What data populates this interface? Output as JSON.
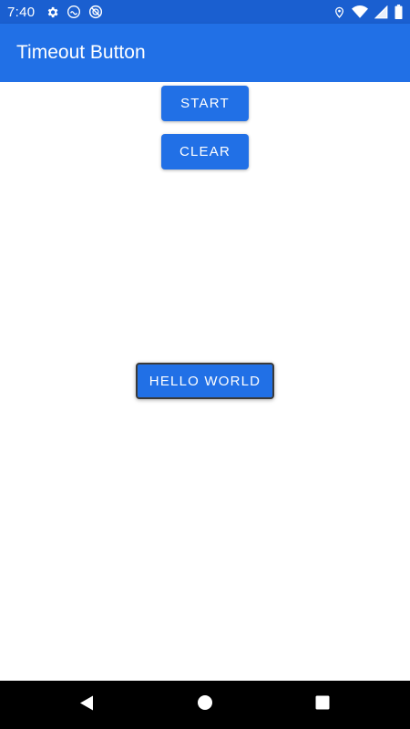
{
  "status_bar": {
    "time": "7:40",
    "left_icons": [
      "gear-icon",
      "android-debug-icon",
      "no-disturb-icon"
    ],
    "right_icons": [
      "location-icon",
      "wifi-icon",
      "signal-icon",
      "battery-icon"
    ]
  },
  "app_bar": {
    "title": "Timeout Button"
  },
  "buttons": {
    "start_label": "START",
    "clear_label": "CLEAR",
    "hello_label": "HELLO WORLD"
  },
  "nav_bar": {
    "icons": [
      "back-icon",
      "home-icon",
      "recents-icon"
    ]
  },
  "colors": {
    "status_bar": "#1a5fd0",
    "app_bar": "#2170e6",
    "button": "#2170e6",
    "nav_bar": "#000000"
  }
}
